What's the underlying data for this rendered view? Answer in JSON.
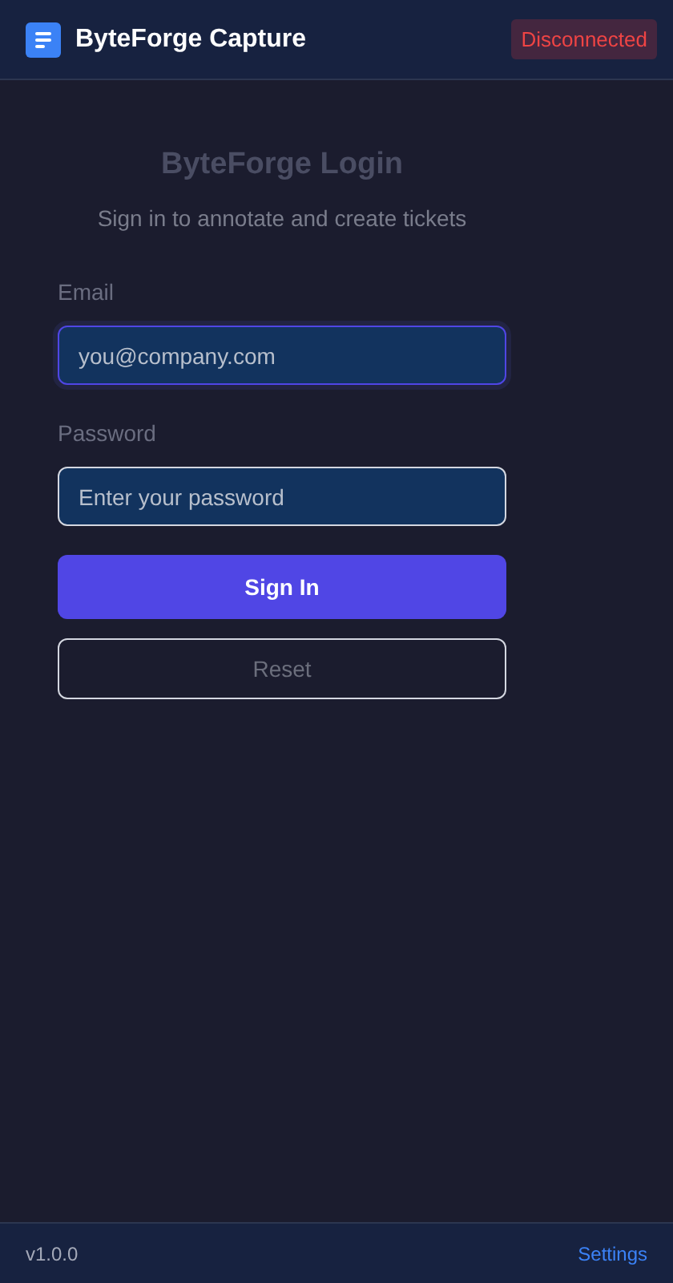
{
  "header": {
    "title": "ByteForge Capture",
    "status": {
      "label": "Disconnected",
      "connected": false
    }
  },
  "login": {
    "title": "ByteForge Login",
    "subtitle": "Sign in to annotate and create tickets",
    "fields": [
      {
        "label": "Email",
        "placeholder": "you@company.com",
        "focused": true
      },
      {
        "label": "Password",
        "placeholder": "Enter your password",
        "focused": false
      }
    ],
    "buttons": [
      {
        "label": "Sign In",
        "kind": "primary"
      },
      {
        "label": "Reset",
        "kind": "outline"
      }
    ]
  },
  "footer": {
    "version": "v1.0.0",
    "link": "Settings"
  }
}
